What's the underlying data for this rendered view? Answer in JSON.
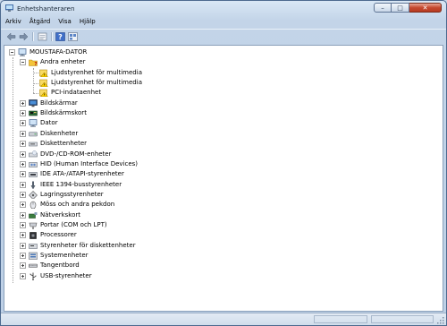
{
  "window": {
    "title": "Enhetshanteraren",
    "minimize": "–",
    "maximize": "□",
    "close": "✕"
  },
  "menu": [
    "Arkiv",
    "Åtgärd",
    "Visa",
    "Hjälp"
  ],
  "toolbar": {
    "icons": [
      "back-arrow-icon",
      "forward-arrow-icon",
      "properties-icon",
      "help-icon",
      "view-icon"
    ]
  },
  "tree": {
    "root": "MOUSTAFA-DATOR",
    "expanded_group": {
      "label": "Andra enheter",
      "children": [
        "Ljudstyrenhet för multimedia",
        "Ljudstyrenhet för multimedia",
        "PCI-indataenhet"
      ]
    },
    "categories": [
      {
        "label": "Bildskärmar",
        "icon": "monitor-icon"
      },
      {
        "label": "Bildskärmskort",
        "icon": "display-adapter-icon"
      },
      {
        "label": "Dator",
        "icon": "computer-icon"
      },
      {
        "label": "Diskenheter",
        "icon": "disk-drive-icon"
      },
      {
        "label": "Diskettenheter",
        "icon": "floppy-drive-icon"
      },
      {
        "label": "DVD-/CD-ROM-enheter",
        "icon": "cd-drive-icon"
      },
      {
        "label": "HID (Human Interface Devices)",
        "icon": "hid-icon"
      },
      {
        "label": "IDE ATA-/ATAPI-styrenheter",
        "icon": "ide-controller-icon"
      },
      {
        "label": "IEEE 1394-busstyrenheter",
        "icon": "firewire-icon"
      },
      {
        "label": "Lagringsstyrenheter",
        "icon": "storage-controller-icon"
      },
      {
        "label": "Möss och andra pekdon",
        "icon": "mouse-icon"
      },
      {
        "label": "Nätverkskort",
        "icon": "network-adapter-icon"
      },
      {
        "label": "Portar (COM och LPT)",
        "icon": "port-icon"
      },
      {
        "label": "Processorer",
        "icon": "processor-icon"
      },
      {
        "label": "Styrenheter för diskettenheter",
        "icon": "floppy-controller-icon"
      },
      {
        "label": "Systemenheter",
        "icon": "system-devices-icon"
      },
      {
        "label": "Tangentbord",
        "icon": "keyboard-icon"
      },
      {
        "label": "USB-styrenheter",
        "icon": "usb-icon"
      }
    ]
  },
  "colors": {
    "warning_folder": "#f3c43a",
    "selection_blue": "#3a6fc4"
  }
}
